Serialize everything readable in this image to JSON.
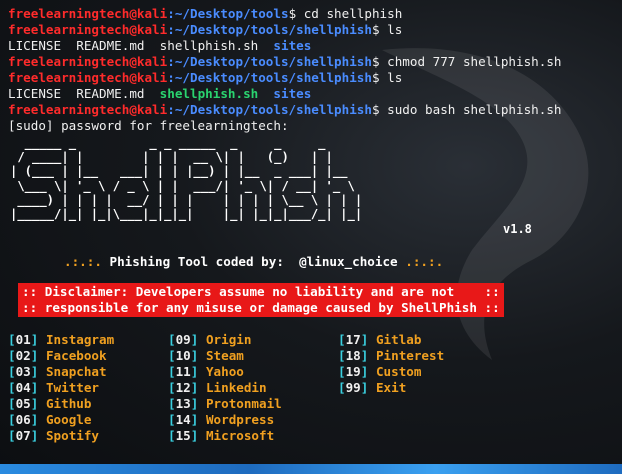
{
  "terminal": {
    "lines": [
      {
        "user": "freelearningtech@kali",
        "path": ":~/Desktop/tools",
        "cmd": "$ cd shellphish"
      },
      {
        "user": "freelearningtech@kali",
        "path": ":~/Desktop/tools/shellphish",
        "cmd": "$ ls"
      },
      {
        "files": [
          "LICENSE",
          "README.md",
          "shellphish.sh",
          "sites"
        ]
      },
      {
        "user": "freelearningtech@kali",
        "path": ":~/Desktop/tools/shellphish",
        "cmd": "$ chmod 777 shellphish.sh"
      },
      {
        "user": "freelearningtech@kali",
        "path": ":~/Desktop/tools/shellphish",
        "cmd": "$ ls"
      },
      {
        "files": [
          "LICENSE",
          "README.md",
          "shellphish.sh",
          "sites"
        ]
      },
      {
        "user": "freelearningtech@kali",
        "path": ":~/Desktop/tools/shellphish",
        "cmd": "$ sudo bash shellphish.sh"
      },
      {
        "text": "[sudo] password for freelearningtech:"
      }
    ],
    "banner_art": "  _____ _          _ _ _____  _     _     _     \n / ____| |        | | |  __ \\| |   (_)   | |    \n| (___ | |__   ___| | | |__) | |__  _ ___| |__  \n \\___ \\| '_ \\ / _ \\ | |  ___/| '_ \\| / __| '_ \\ \n ____) | | | |  __/ | | |    | | | | \\__ \\ | | |\n|_____/|_| |_|\\___|_|_|_|    |_| |_|_|___/_| |_|",
    "version": "v1.8",
    "tagline_dots_left": ".:.:.",
    "tagline_text": "Phishing Tool coded by:  @linux_choice",
    "tagline_dots_right": ".:.:.",
    "disclaimer_line1": ":: Disclaimer: Developers assume no liability and are not    ::",
    "disclaimer_line2": ":: responsible for any misuse or damage caused by ShellPhish ::",
    "menu": [
      [
        {
          "num": "01",
          "label": "Instagram"
        },
        {
          "num": "02",
          "label": "Facebook"
        },
        {
          "num": "03",
          "label": "Snapchat"
        },
        {
          "num": "04",
          "label": "Twitter"
        },
        {
          "num": "05",
          "label": "Github"
        },
        {
          "num": "06",
          "label": "Google"
        },
        {
          "num": "07",
          "label": "Spotify"
        }
      ],
      [
        {
          "num": "09",
          "label": "Origin"
        },
        {
          "num": "10",
          "label": "Steam"
        },
        {
          "num": "11",
          "label": "Yahoo"
        },
        {
          "num": "12",
          "label": "Linkedin"
        },
        {
          "num": "13",
          "label": "Protonmail"
        },
        {
          "num": "14",
          "label": "Wordpress"
        },
        {
          "num": "15",
          "label": "Microsoft"
        }
      ],
      [
        {
          "num": "17",
          "label": "Gitlab"
        },
        {
          "num": "18",
          "label": "Pinterest"
        },
        {
          "num": "19",
          "label": "Custom"
        },
        {
          "num": "99",
          "label": "Exit"
        }
      ]
    ]
  },
  "colors": {
    "prompt_user": "#ff2b2b",
    "prompt_path": "#4a8cff",
    "executable": "#2ad36f",
    "menu_label": "#f0a020",
    "bracket": "#3ad0e0",
    "disclaimer_bg": "#e81818"
  }
}
